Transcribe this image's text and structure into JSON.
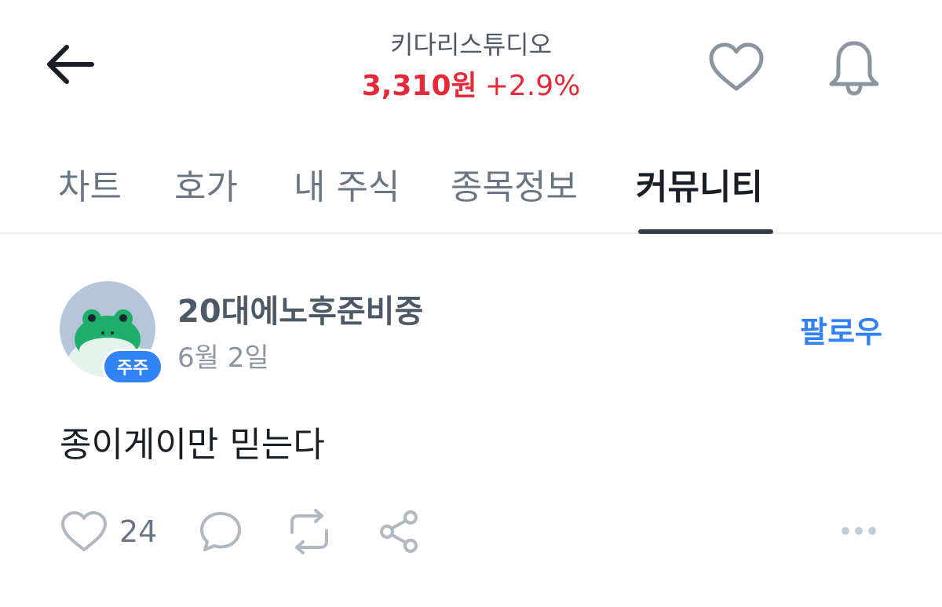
{
  "header": {
    "stock_name": "키다리스튜디오",
    "price": "3,310원",
    "change": "+2.9%",
    "back_icon": "arrow-left-icon",
    "favorite_icon": "heart-outline-icon",
    "notification_icon": "bell-icon"
  },
  "tabs": [
    {
      "label": "차트",
      "active": false
    },
    {
      "label": "호가",
      "active": false
    },
    {
      "label": "내 주식",
      "active": false
    },
    {
      "label": "종목정보",
      "active": false
    },
    {
      "label": "커뮤니티",
      "active": true
    }
  ],
  "post": {
    "author": "20대에노후준비중",
    "badge": "주주",
    "date": "6월 2일",
    "follow_label": "팔로우",
    "text": "종이게이만 믿는다",
    "avatar_icon": "frog-avatar-icon",
    "actions": {
      "like_count": "24",
      "like_icon": "heart-outline-icon",
      "comment_icon": "comment-bubble-icon",
      "repost_icon": "repost-icon",
      "share_icon": "share-icon",
      "more_icon": "more-horizontal-icon"
    }
  },
  "colors": {
    "price_up": "#e42939",
    "accent": "#3182f6",
    "text_primary": "#191f28",
    "text_secondary": "#6b7684",
    "icon_gray": "#8b95a1"
  }
}
